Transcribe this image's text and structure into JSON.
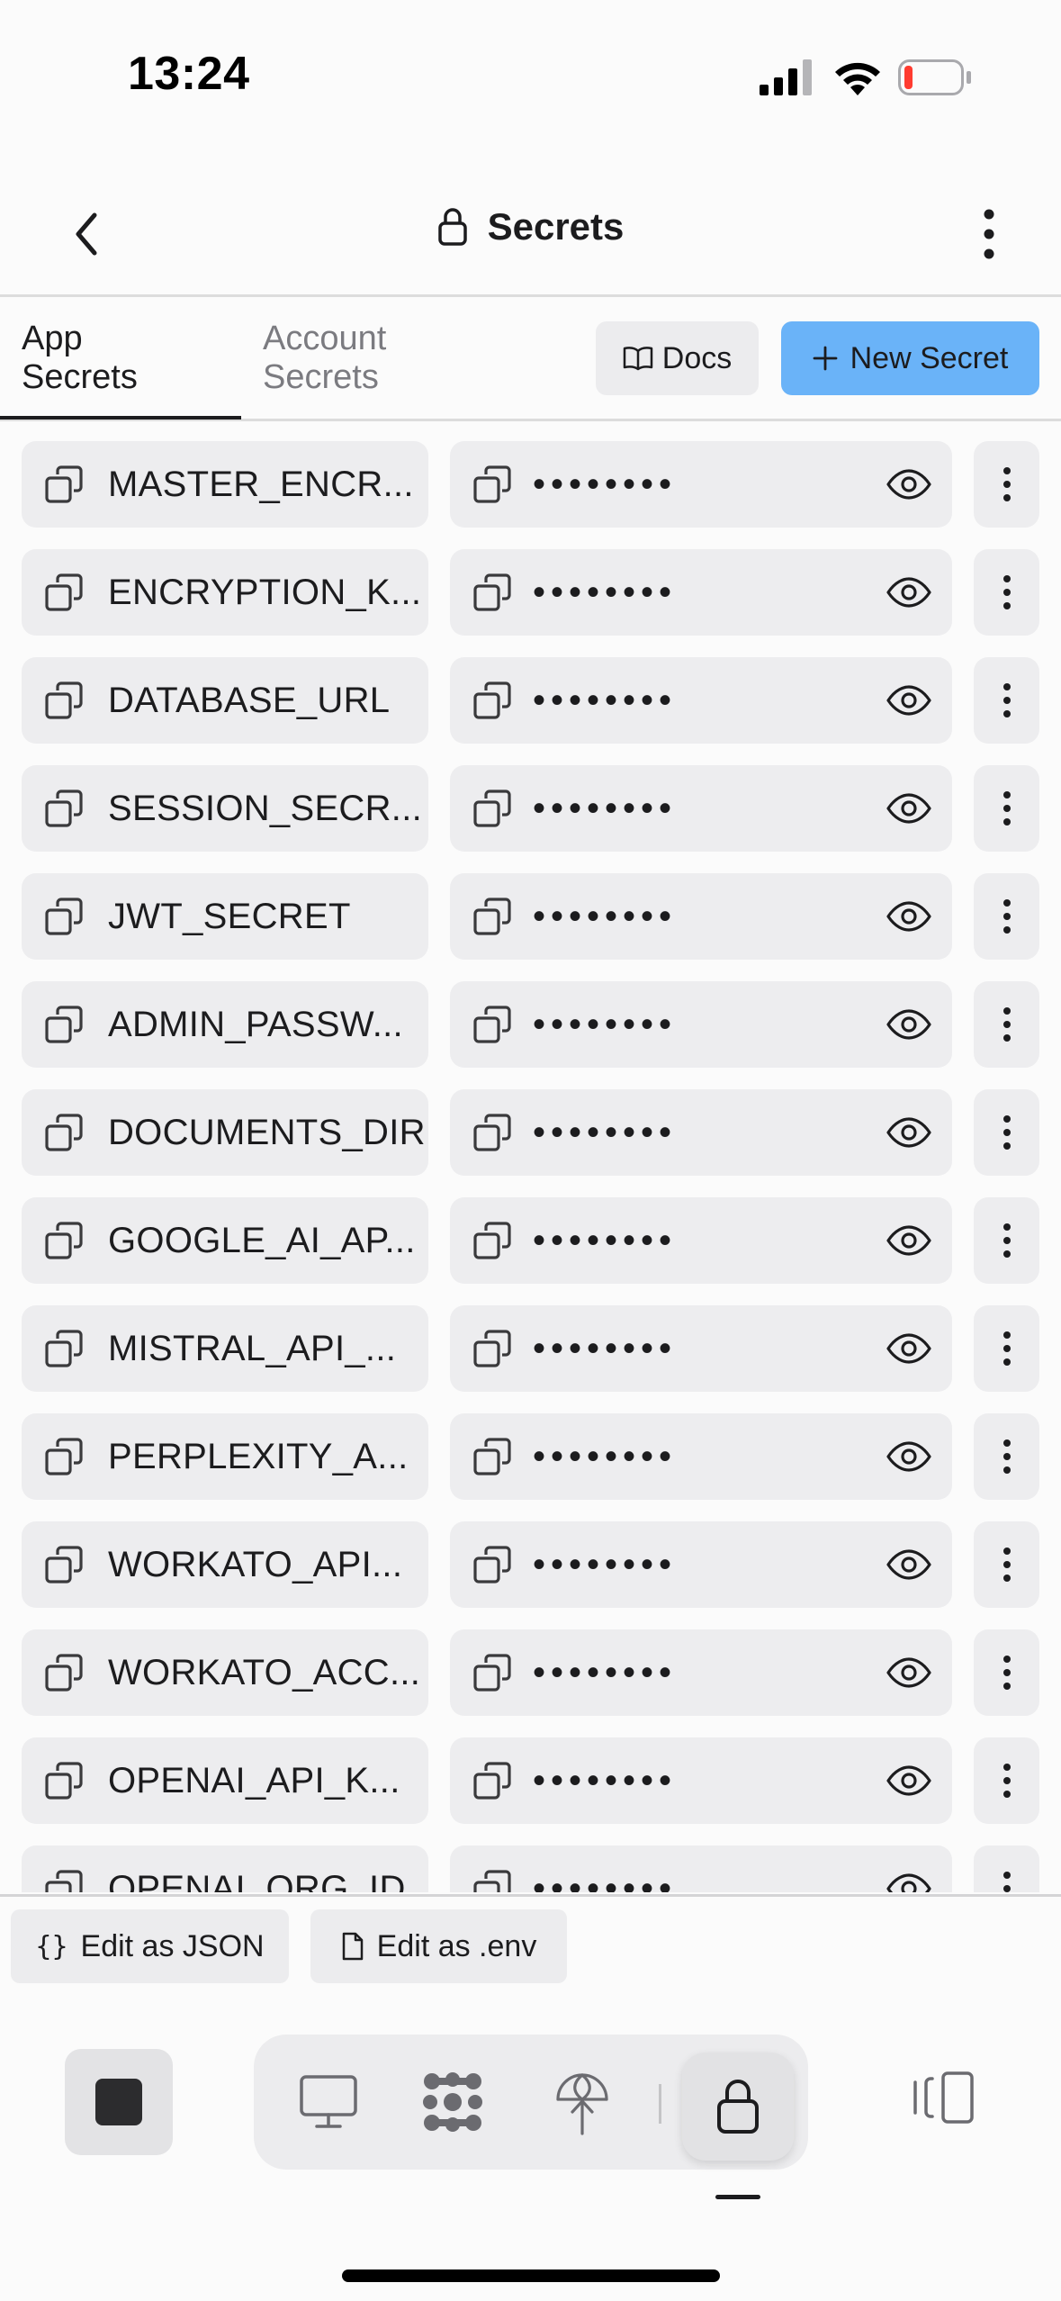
{
  "status_bar": {
    "time": "13:24",
    "battery_color": "#ff3b30"
  },
  "header": {
    "title": "Secrets",
    "title_icon": "lock-icon"
  },
  "tabs": [
    {
      "label_line1": "App",
      "label_line2": "Secrets",
      "active": true
    },
    {
      "label_line1": "Account",
      "label_line2": "Secrets",
      "active": false
    }
  ],
  "actions": {
    "docs_label": "Docs",
    "new_secret_label": "New Secret",
    "new_secret_color": "#6ab3f8"
  },
  "secrets": [
    {
      "key": "MASTER_ENCR...",
      "value": "••••••••"
    },
    {
      "key": "ENCRYPTION_K...",
      "value": "••••••••"
    },
    {
      "key": "DATABASE_URL",
      "value": "••••••••"
    },
    {
      "key": "SESSION_SECR...",
      "value": "••••••••"
    },
    {
      "key": "JWT_SECRET",
      "value": "••••••••"
    },
    {
      "key": "ADMIN_PASSW...",
      "value": "••••••••"
    },
    {
      "key": "DOCUMENTS_DIR",
      "value": "••••••••"
    },
    {
      "key": "GOOGLE_AI_AP...",
      "value": "••••••••"
    },
    {
      "key": "MISTRAL_API_...",
      "value": "••••••••"
    },
    {
      "key": "PERPLEXITY_A...",
      "value": "••••••••"
    },
    {
      "key": "WORKATO_API...",
      "value": "••••••••"
    },
    {
      "key": "WORKATO_ACC...",
      "value": "••••••••"
    },
    {
      "key": "OPENAI_API_K...",
      "value": "••••••••"
    },
    {
      "key": "OPENAI_ORG_ID",
      "value": "••••••••"
    }
  ],
  "edit_bar": {
    "json_label": "Edit as JSON",
    "env_label": "Edit as .env"
  },
  "dock": {
    "items": [
      "stop-icon",
      "monitor-icon",
      "apps-grid-icon",
      "deploy-icon",
      "lock-icon",
      "sidebar-toggle-icon"
    ],
    "active_item": "lock-icon"
  }
}
